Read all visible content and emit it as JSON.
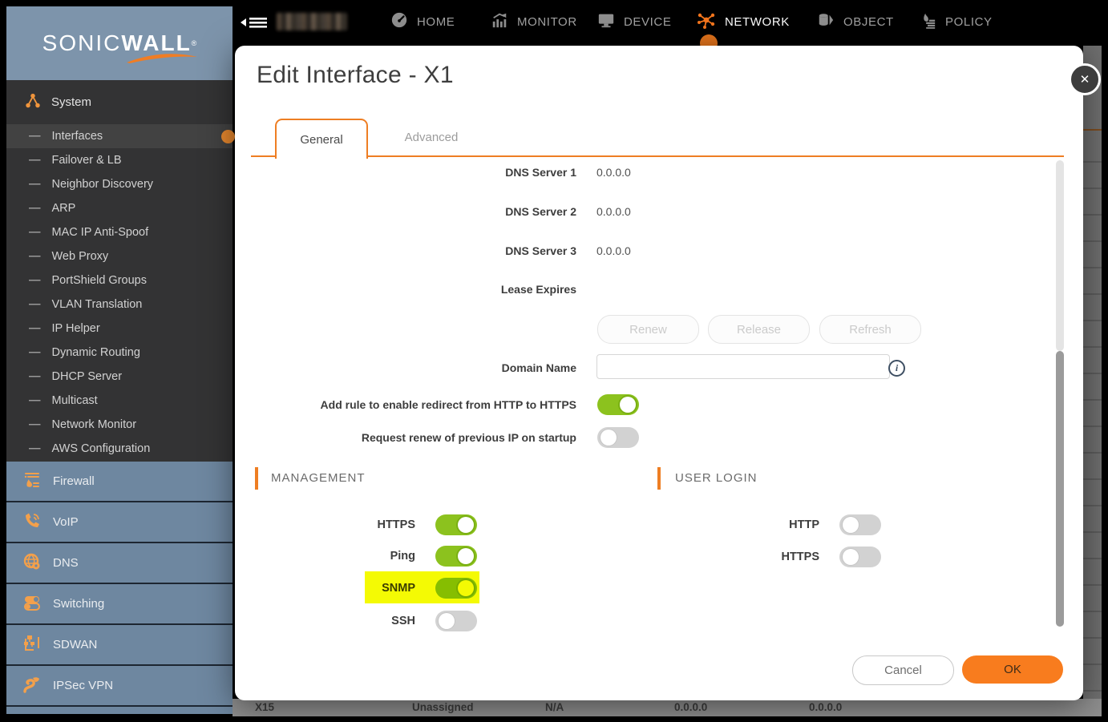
{
  "top_nav": {
    "items": [
      {
        "label": "HOME",
        "active": false
      },
      {
        "label": "MONITOR",
        "active": false
      },
      {
        "label": "DEVICE",
        "active": false
      },
      {
        "label": "NETWORK",
        "active": true
      },
      {
        "label": "OBJECT",
        "active": false
      },
      {
        "label": "POLICY",
        "active": false
      }
    ]
  },
  "sidebar": {
    "logo": {
      "brand_light": "SONIC",
      "brand_bold": "WALL",
      "registered": "®"
    },
    "system_label": "System",
    "sub_items": [
      {
        "label": "Interfaces",
        "active": true
      },
      {
        "label": "Failover & LB",
        "active": false
      },
      {
        "label": "Neighbor Discovery",
        "active": false
      },
      {
        "label": "ARP",
        "active": false
      },
      {
        "label": "MAC IP Anti-Spoof",
        "active": false
      },
      {
        "label": "Web Proxy",
        "active": false
      },
      {
        "label": "PortShield Groups",
        "active": false
      },
      {
        "label": "VLAN Translation",
        "active": false
      },
      {
        "label": "IP Helper",
        "active": false
      },
      {
        "label": "Dynamic Routing",
        "active": false
      },
      {
        "label": "DHCP Server",
        "active": false
      },
      {
        "label": "Multicast",
        "active": false
      },
      {
        "label": "Network Monitor",
        "active": false
      },
      {
        "label": "AWS Configuration",
        "active": false
      }
    ],
    "sections": [
      {
        "label": "Firewall"
      },
      {
        "label": "VoIP"
      },
      {
        "label": "DNS"
      },
      {
        "label": "Switching"
      },
      {
        "label": "SDWAN"
      },
      {
        "label": "IPSec VPN"
      }
    ]
  },
  "modal": {
    "title": "Edit Interface - X1",
    "tabs": [
      {
        "label": "General",
        "active": true
      },
      {
        "label": "Advanced",
        "active": false
      }
    ],
    "fields": {
      "dns1": {
        "label": "DNS Server 1",
        "value": "0.0.0.0"
      },
      "dns2": {
        "label": "DNS Server 2",
        "value": "0.0.0.0"
      },
      "dns3": {
        "label": "DNS Server 3",
        "value": "0.0.0.0"
      },
      "lease": {
        "label": "Lease Expires",
        "value": ""
      },
      "domain": {
        "label": "Domain Name",
        "value": "",
        "placeholder": ""
      }
    },
    "buttons": {
      "renew": "Renew",
      "release": "Release",
      "refresh": "Refresh",
      "cancel": "Cancel",
      "ok": "OK"
    },
    "toggles": {
      "redirect": {
        "label": "Add rule to enable redirect from HTTP to HTTPS",
        "on": true
      },
      "renew_ip": {
        "label": "Request renew of previous IP on startup",
        "on": false
      }
    },
    "management": {
      "title": "MANAGEMENT",
      "items": [
        {
          "label": "HTTPS",
          "on": true,
          "highlighted": false
        },
        {
          "label": "Ping",
          "on": true,
          "highlighted": false
        },
        {
          "label": "SNMP",
          "on": true,
          "highlighted": true
        },
        {
          "label": "SSH",
          "on": false,
          "highlighted": false
        }
      ]
    },
    "user_login": {
      "title": "USER LOGIN",
      "items": [
        {
          "label": "HTTP",
          "on": false
        },
        {
          "label": "HTTPS",
          "on": false
        }
      ]
    }
  },
  "background_table": {
    "visible_row": {
      "c1": "X15",
      "c2": "Unassigned",
      "c3": "N/A",
      "c4": "0.0.0.0",
      "c5": "0.0.0.0"
    }
  },
  "colors": {
    "accent_orange": "#ee7e23",
    "toggle_on_green": "#8cc21e",
    "highlight_yellow": "#f4fa04",
    "sidebar_blue": "#6e87a0",
    "logo_blue": "#7d94ab"
  }
}
